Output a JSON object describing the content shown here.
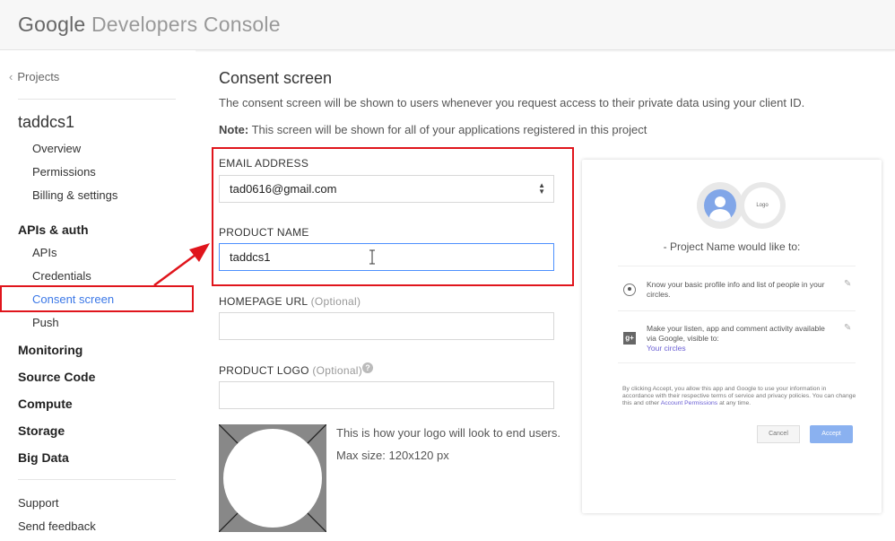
{
  "header": {
    "brand_google": "Google",
    "brand_product": "Developers Console"
  },
  "sidebar": {
    "back_label": "Projects",
    "project_name": "taddcs1",
    "project_items": [
      "Overview",
      "Permissions",
      "Billing & settings"
    ],
    "apis_section": "APIs & auth",
    "apis_items": [
      "APIs",
      "Credentials",
      "Consent screen",
      "Push"
    ],
    "sections": [
      "Monitoring",
      "Source Code",
      "Compute",
      "Storage",
      "Big Data"
    ],
    "footer_links": [
      "Support",
      "Send feedback"
    ]
  },
  "main": {
    "title": "Consent screen",
    "description": "The consent screen will be shown to users whenever you request access to their private data using your client ID.",
    "note_label": "Note:",
    "note_text": "This screen will be shown for all of your applications registered in this project",
    "email_label": "EMAIL ADDRESS",
    "email_value": "tad0616@gmail.com",
    "product_label": "PRODUCT NAME",
    "product_value": "taddcs1",
    "homepage_label": "HOMEPAGE URL",
    "homepage_optional": "(Optional)",
    "homepage_value": "",
    "logo_label": "PRODUCT LOGO",
    "logo_optional": "(Optional)",
    "logo_value": "",
    "logo_hint": "This is how your logo will look to end users.",
    "logo_size": "Max size: 120x120 px"
  },
  "preview": {
    "logo_text": "Logo",
    "heading": "- Project Name would like to:",
    "item1": "Know your basic profile info and list of people in your circles.",
    "item2": "Make your listen, app and comment activity available via Google, visible to:",
    "item2_link": "Your circles",
    "footer_before": "By clicking Accept, you allow this app and Google to use your information in accordance with their respective terms of service and privacy policies. You can change this and other",
    "footer_link": "Account Permissions",
    "footer_after": "at any time.",
    "cancel": "Cancel",
    "accept": "Accept"
  },
  "colors": {
    "highlight": "#e0151c",
    "link": "#3b78e7",
    "accept": "#8ab1f0"
  }
}
